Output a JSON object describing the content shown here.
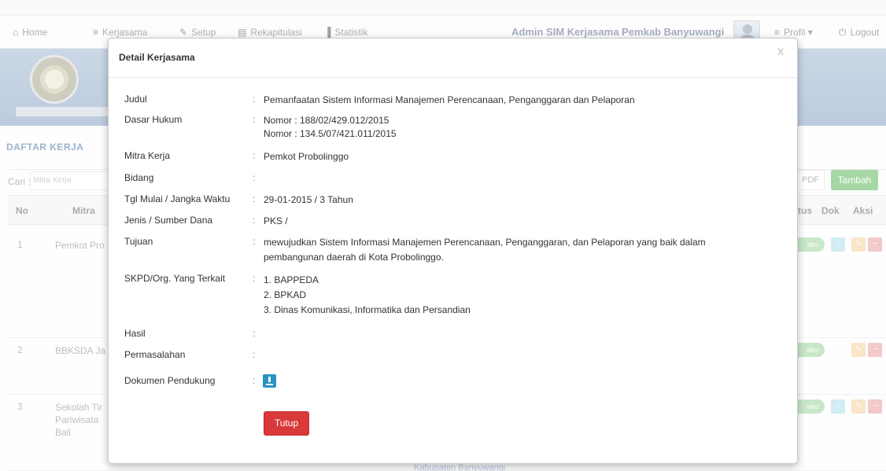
{
  "nav": {
    "home": "Home",
    "kerjasama": "Kerjasama",
    "setup": "Setup",
    "rekapitulasi": "Rekapitulasi",
    "statistik": "Statistik",
    "title": "Admin SIM Kerjasama Pemkab Banyuwangi",
    "profil": "Profil",
    "logout": "Logout"
  },
  "list": {
    "section_title": "DAFTAR KERJA",
    "cari_label": "Cari :",
    "search_placeholder": "Mitra Kerja",
    "pdf_button": "PDF",
    "add_button": "Tambah",
    "columns": {
      "no": "No",
      "mitra": "Mitra",
      "status": "tus",
      "dok": "Dok",
      "aksi": "Aksi"
    },
    "rows": [
      {
        "no": "1",
        "mitra": "Pemkot Pro",
        "badge": "aku"
      },
      {
        "no": "2",
        "mitra": "BBKSDA Ja",
        "badge": "aku"
      },
      {
        "no": "3",
        "mitra": "Sekolah Tir\nPariwisata \nBali",
        "badge": "aku"
      }
    ],
    "footer_text": "Kabupaten Banyuwangi"
  },
  "modal": {
    "title": "Detail Kerjasama",
    "close": "X",
    "fields": [
      {
        "label": "Judul",
        "value": "Pemanfaatan Sistem Informasi Manajemen Perencanaan, Penganggaran dan Pelaporan"
      },
      {
        "label": "Dasar Hukum",
        "value_lines": [
          "Nomor : 188/02/429.012/2015",
          "Nomor : 134.5/07/421.011/2015"
        ]
      },
      {
        "label": "Mitra Kerja",
        "value": "Pemkot Probolinggo"
      },
      {
        "label": "Bidang",
        "value": ""
      },
      {
        "label": "Tgl Mulai / Jangka Waktu",
        "value": "29-01-2015 / 3 Tahun"
      },
      {
        "label": "Jenis / Sumber Dana",
        "value": "PKS /"
      },
      {
        "label": "Tujuan",
        "value_lines": [
          "mewujudkan Sistem Informasi Manajemen Perencanaan, Penganggaran, dan Pelaporan yang baik dalam",
          "pembangunan daerah di Kota Probolinggo."
        ]
      },
      {
        "label": "SKPD/Org. Yang Terkait",
        "value_lines": [
          "1. BAPPEDA",
          "2. BPKAD",
          "3. Dinas Komunikasi, Informatika dan Persandian"
        ]
      },
      {
        "label": "Hasil",
        "value": ""
      },
      {
        "label": "Permasalahan",
        "value": ""
      },
      {
        "label": "Dokumen Pendukung",
        "value": ""
      }
    ],
    "close_button": "Tutup"
  },
  "colors": {
    "accent_blue": "#2b93c0",
    "danger": "#d9393a",
    "success": "#5cb85c"
  }
}
